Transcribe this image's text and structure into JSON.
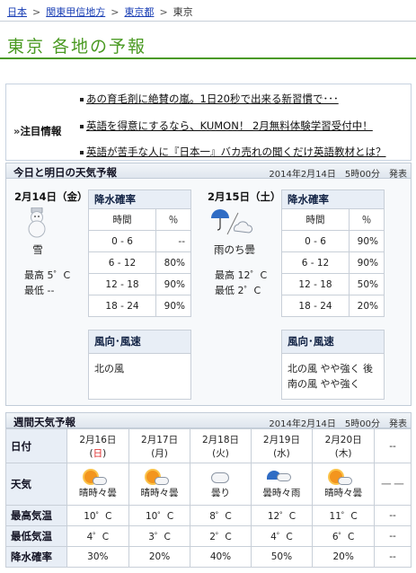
{
  "breadcrumb": {
    "items": [
      "日本",
      "関東甲信地方",
      "東京都"
    ],
    "separator": ">",
    "current": "東京"
  },
  "page_title": "東京 各地の予報",
  "ads": {
    "label": "注目情報",
    "items": [
      "あの育毛剤に絶賛の嵐。1日20秒で出来る新習慣で･･･",
      "英語を得意にするなら、KUMON！ 2月無料体験学習受付中！",
      "英語が苦手な人に『日本一』バカ売れの聞くだけ英語教材とは？"
    ]
  },
  "today": {
    "header": "今日と明日の天気予報",
    "issued": "2014年2月14日　5時00分　発表",
    "days": [
      {
        "date": "2月14日（金）",
        "weather": "雪",
        "high": "最高 5゜C",
        "low": "最低 --",
        "rain": {
          "caption": "降水確率",
          "col_time": "時間",
          "col_pct": "％",
          "rows": [
            {
              "time": "0 - 6",
              "pct": "--"
            },
            {
              "time": "6 - 12",
              "pct": "80%"
            },
            {
              "time": "12 - 18",
              "pct": "90%"
            },
            {
              "time": "18 - 24",
              "pct": "90%"
            }
          ]
        },
        "wind": {
          "caption": "風向･風速",
          "lines": [
            "北の風"
          ]
        }
      },
      {
        "date": "2月15日（土）",
        "weather": "雨のち曇",
        "high": "最高 12゜C",
        "low": "最低 2゜C",
        "rain": {
          "caption": "降水確率",
          "col_time": "時間",
          "col_pct": "％",
          "rows": [
            {
              "time": "0 - 6",
              "pct": "90%"
            },
            {
              "time": "6 - 12",
              "pct": "90%"
            },
            {
              "time": "12 - 18",
              "pct": "50%"
            },
            {
              "time": "18 - 24",
              "pct": "20%"
            }
          ]
        },
        "wind": {
          "caption": "風向･風速",
          "lines": [
            "北の風 やや強く 後",
            "南の風 やや強く"
          ]
        }
      }
    ]
  },
  "weekly": {
    "header": "週間天気予報",
    "issued": "2014年2月14日　5時00分　発表",
    "rows": {
      "date": "日付",
      "weather": "天気",
      "high": "最高気温",
      "low": "最低気温",
      "rain": "降水確率"
    },
    "days": [
      {
        "date_md": "2月16日",
        "dow": "日",
        "dow_color": "#d22",
        "icon": "sun-cloud",
        "weather": "晴時々曇",
        "high": "10゜C",
        "low": "4゜C",
        "rain": "30%"
      },
      {
        "date_md": "2月17日",
        "dow": "月",
        "dow_color": "#222",
        "icon": "sun-cloud",
        "weather": "晴時々曇",
        "high": "10゜C",
        "low": "3゜C",
        "rain": "20%"
      },
      {
        "date_md": "2月18日",
        "dow": "火",
        "dow_color": "#222",
        "icon": "cloud",
        "weather": "曇り",
        "high": "8゜C",
        "low": "2゜C",
        "rain": "40%"
      },
      {
        "date_md": "2月19日",
        "dow": "水",
        "dow_color": "#222",
        "icon": "cloud-umbrella",
        "weather": "曇時々雨",
        "high": "12゜C",
        "low": "4゜C",
        "rain": "50%"
      },
      {
        "date_md": "2月20日",
        "dow": "木",
        "dow_color": "#222",
        "icon": "sun-cloud",
        "weather": "晴時々曇",
        "high": "11゜C",
        "low": "6゜C",
        "rain": "20%"
      },
      {
        "date_md": "--",
        "dow": "",
        "dow_color": "#222",
        "icon": "none",
        "weather": "",
        "high": "--",
        "low": "--",
        "rain": "--"
      }
    ]
  }
}
